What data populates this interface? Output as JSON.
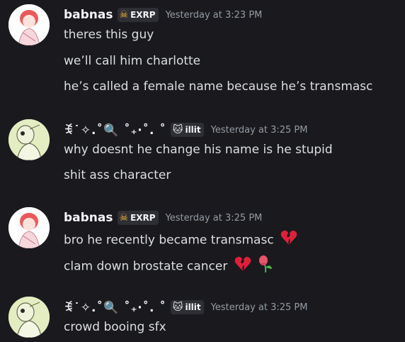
{
  "colors": {
    "background": "#1a1a1e",
    "username": "#f2f3f5",
    "message_text": "#dbdee1",
    "timestamp": "#949ba4",
    "tag_bg": "#2e2f35"
  },
  "messages": [
    {
      "author": "babnas",
      "tag": "EXRP",
      "tag_icon": "skull-icon",
      "timestamp": "Yesterday at 3:23 PM",
      "lines": [
        "theres this guy",
        "we’ll call him charlotte",
        "he’s called a female name because he’s transmasc"
      ]
    },
    {
      "author": "ꉂ˙✧.˚🔍 ˚₊‧˚. ˚",
      "tag": "illit",
      "tag_icon": "cat-icon",
      "timestamp": "Yesterday at 3:25 PM",
      "lines": [
        "why doesnt he change his name is he stupid",
        "shit ass character"
      ]
    },
    {
      "author": "babnas",
      "tag": "EXRP",
      "tag_icon": "skull-icon",
      "timestamp": "Yesterday at 3:25 PM",
      "lines": [
        "bro he recently became transmasc",
        "clam down brostate cancer"
      ]
    },
    {
      "author": "ꉂ˙✧.˚🔍 ˚₊‧˚. ˚",
      "tag": "illit",
      "tag_icon": "cat-icon",
      "timestamp": "Yesterday at 3:25 PM",
      "lines": [
        "crowd booing sfx"
      ]
    }
  ]
}
